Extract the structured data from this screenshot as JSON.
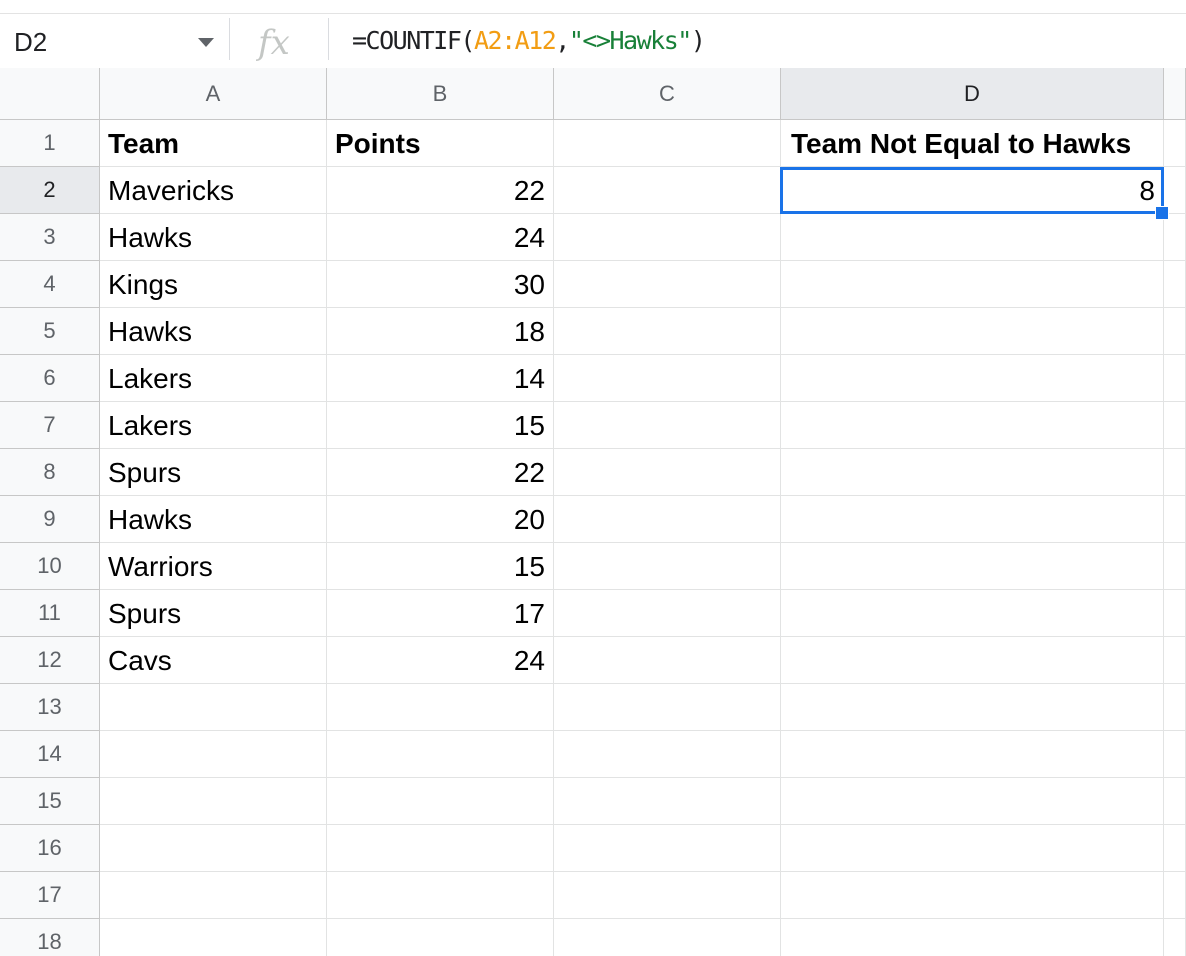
{
  "name_box": {
    "ref": "D2"
  },
  "formula_bar": {
    "prefix": "=COUNTIF(",
    "range": "A2:A12",
    "comma": ",",
    "criteria": "\"<>Hawks\"",
    "suffix": ")"
  },
  "columns": [
    "A",
    "B",
    "C",
    "D"
  ],
  "selected_column": "D",
  "selected_row": "2",
  "row_headers": [
    "1",
    "2",
    "3",
    "4",
    "5",
    "6",
    "7",
    "8",
    "9",
    "10",
    "11",
    "12",
    "13",
    "14",
    "15",
    "16",
    "17",
    "18"
  ],
  "rows": [
    {
      "a": "Team",
      "b": "Points",
      "d": "Team Not Equal to Hawks"
    },
    {
      "a": "Mavericks",
      "b": "22",
      "d": "8"
    },
    {
      "a": "Hawks",
      "b": "24"
    },
    {
      "a": "Kings",
      "b": "30"
    },
    {
      "a": "Hawks",
      "b": "18"
    },
    {
      "a": "Lakers",
      "b": "14"
    },
    {
      "a": "Lakers",
      "b": "15"
    },
    {
      "a": "Spurs",
      "b": "22"
    },
    {
      "a": "Hawks",
      "b": "20"
    },
    {
      "a": "Warriors",
      "b": "15"
    },
    {
      "a": "Spurs",
      "b": "17"
    },
    {
      "a": "Cavs",
      "b": "24"
    }
  ],
  "colors": {
    "selection": "#1a73e8",
    "range_ref": "#f29d13",
    "string": "#188038"
  }
}
